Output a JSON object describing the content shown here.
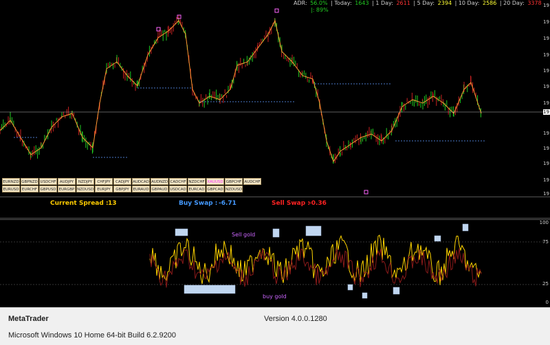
{
  "adr": {
    "adr_label": "ADR:",
    "adr_value": "56.0%",
    "today_label": "| Today:",
    "today_value": "1643",
    "day1_label": "| 1 Day:",
    "day1_value": "2611",
    "day5_label": "| 5 Day:",
    "day5_value": "2394",
    "day10_label": "| 10 Day:",
    "day10_value": "2586",
    "day20_label": "| 20 Day:",
    "day20_value": "3378",
    "percent": "|: 89%",
    "colors": {
      "label": "#d0d0d0",
      "adr": "#22cc22",
      "today": "#22cc22",
      "day1": "#ff3333",
      "day5": "#ffff33",
      "day10": "#ffff33",
      "day20": "#ff3333"
    }
  },
  "pairs": {
    "row1": [
      "EURNZD",
      "GBPNZD",
      "USDCHF",
      "AUDJPY",
      "NZDJPY",
      "CHFJPY",
      "CADJPY",
      "AUDCAD",
      "AUDNZD",
      "CADCHF",
      "NZDCHF",
      "XAUUSD",
      "GBPCHF",
      "AUDCHF"
    ],
    "row2": [
      "EURUSD",
      "EURCHF",
      "GBPUSD",
      "EURGBP",
      "NZDUSD",
      "EURJPY",
      "GBPJPY",
      "EURAUD",
      "GBPAUD",
      "USDCAD",
      "EURCAD",
      "GBPCAD",
      "NZDUSD"
    ],
    "active": "XAUUSD"
  },
  "info": {
    "spread_label": "Current Spread :",
    "spread_value": "13",
    "buy_swap_label": "Buy Swap :",
    "buy_swap_value": "-6.71",
    "sell_swap_label": "Sell Swap :",
    "sell_swap_value": "-0.36",
    "colors": {
      "spread": "#ffcc00",
      "buy": "#4499ff",
      "sell": "#ff2222"
    }
  },
  "oscillator": {
    "sell_label": "Sell gold",
    "buy_label": "buy gold",
    "levels": [
      "100",
      "75",
      "25",
      "0"
    ]
  },
  "footer": {
    "app_name": "MetaTrader",
    "version": "Version 4.0.0.1280",
    "os": "Microsoft Windows 10 Home 64-bit Build 6.2.9200"
  },
  "icons": [
    "price-axis-icon",
    "fractal-marker-icon"
  ]
}
